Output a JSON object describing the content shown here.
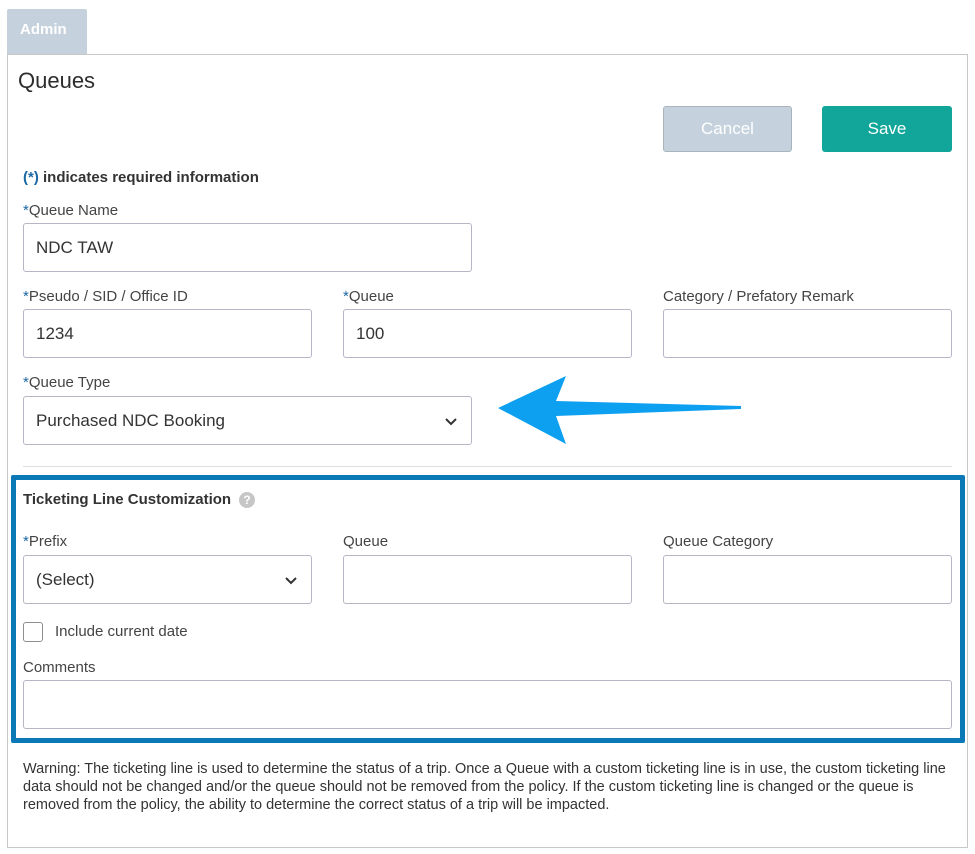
{
  "tab": {
    "label": "Admin"
  },
  "page": {
    "title": "Queues"
  },
  "actions": {
    "cancel_label": "Cancel",
    "save_label": "Save"
  },
  "required_note": {
    "star": "(*)",
    "text": " indicates required information"
  },
  "form": {
    "queue_name": {
      "label": "Queue Name",
      "value": "NDC TAW"
    },
    "pseudo": {
      "label": "Pseudo / SID / Office ID",
      "value": "1234"
    },
    "queue": {
      "label": "Queue",
      "value": "100"
    },
    "category": {
      "label": "Category / Prefatory Remark",
      "value": ""
    },
    "queue_type": {
      "label": "Queue Type",
      "value": "Purchased NDC Booking"
    }
  },
  "ticketing": {
    "title": "Ticketing Line Customization",
    "help_icon": "question-mark-icon",
    "prefix": {
      "label": "Prefix",
      "value": "(Select)"
    },
    "queue": {
      "label": "Queue",
      "value": ""
    },
    "queue_category": {
      "label": "Queue Category",
      "value": ""
    },
    "include_date": {
      "label": "Include current date",
      "checked": false
    },
    "comments": {
      "label": "Comments",
      "value": ""
    }
  },
  "warning": "Warning: The ticketing line is used to determine the status of a trip. Once a Queue with a custom ticketing line is in use, the custom ticketing line data should not be changed and/or the queue should not be removed from the policy. If the custom ticketing line is changed or the queue is removed from the policy, the ability to determine the correct status of a trip will be impacted.",
  "colors": {
    "accent": "#12a59a",
    "highlight_border": "#0a79b5",
    "arrow": "#0ea0f0",
    "required_star": "#1a67a3"
  }
}
